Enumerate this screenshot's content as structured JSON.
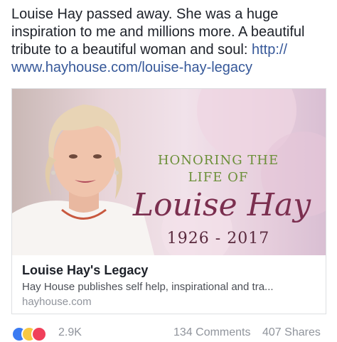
{
  "post": {
    "text": "Louise Hay passed away. She was a huge inspiration to me and millions more. A beautiful tribute to a beautiful woman and soul: ",
    "link": "http:// www.hayhouse.com/louise-hay-legacy"
  },
  "card": {
    "image_text": {
      "honoring_line1": "HONORING THE",
      "honoring_line2": "LIFE OF",
      "name": "Louise Hay",
      "years": "1926 - 2017"
    },
    "title": "Louise Hay's Legacy",
    "description": "Hay House publishes self help, inspirational and tra...",
    "domain": "hayhouse.com"
  },
  "footer": {
    "reaction_icons": [
      "like-icon",
      "haha-icon",
      "love-icon"
    ],
    "reaction_count": "2.9K",
    "comments": "134 Comments",
    "shares": "407 Shares"
  },
  "colors": {
    "link": "#365899",
    "like": "#3b7bf2",
    "haha": "#f7c843",
    "love": "#f0405a",
    "honoring_text": "#6b8f38",
    "name_script": "#7b2f4f"
  }
}
